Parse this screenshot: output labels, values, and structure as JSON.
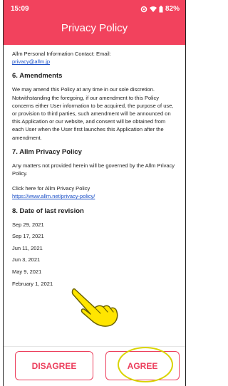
{
  "status_bar": {
    "time": "15:09",
    "battery": "82%"
  },
  "header": {
    "title": "Privacy Policy"
  },
  "content": {
    "contact_text": "Allm Personal Information Contact: Email:",
    "contact_email": "privacy@allm.jp",
    "section6_heading": "6. Amendments",
    "section6_text": "We may amend this Policy at any time in our sole discretion. Notwithstanding the foregoing, if our amendment to this Policy concerns either User information to be acquired, the purpose of use, or provision to third parties, such amendment will be announced on this Application or our website, and consent will be obtained from each User when the User first launches this Application after the amendment.",
    "section7_heading": "7. Allm Privacy Policy",
    "section7_text": "Any matters not provided herein will be governed by the Allm Privacy Policy.",
    "privacy_link_prompt": "Click here for Allm Privacy Policy",
    "privacy_link_url": "https://www.allm.net/privacy-policy/",
    "section8_heading": "8. Date of last revision",
    "revision_dates": [
      "Sep 29, 2021",
      "Sep 17, 2021",
      "Jun 11, 2021",
      "Jun 3, 2021",
      "May 9, 2021",
      "February 1, 2021"
    ]
  },
  "buttons": {
    "disagree": "DISAGREE",
    "agree": "AGREE"
  },
  "colors": {
    "accent": "#f2425d",
    "link": "#1a4fc7",
    "highlight": "#d9d400"
  }
}
